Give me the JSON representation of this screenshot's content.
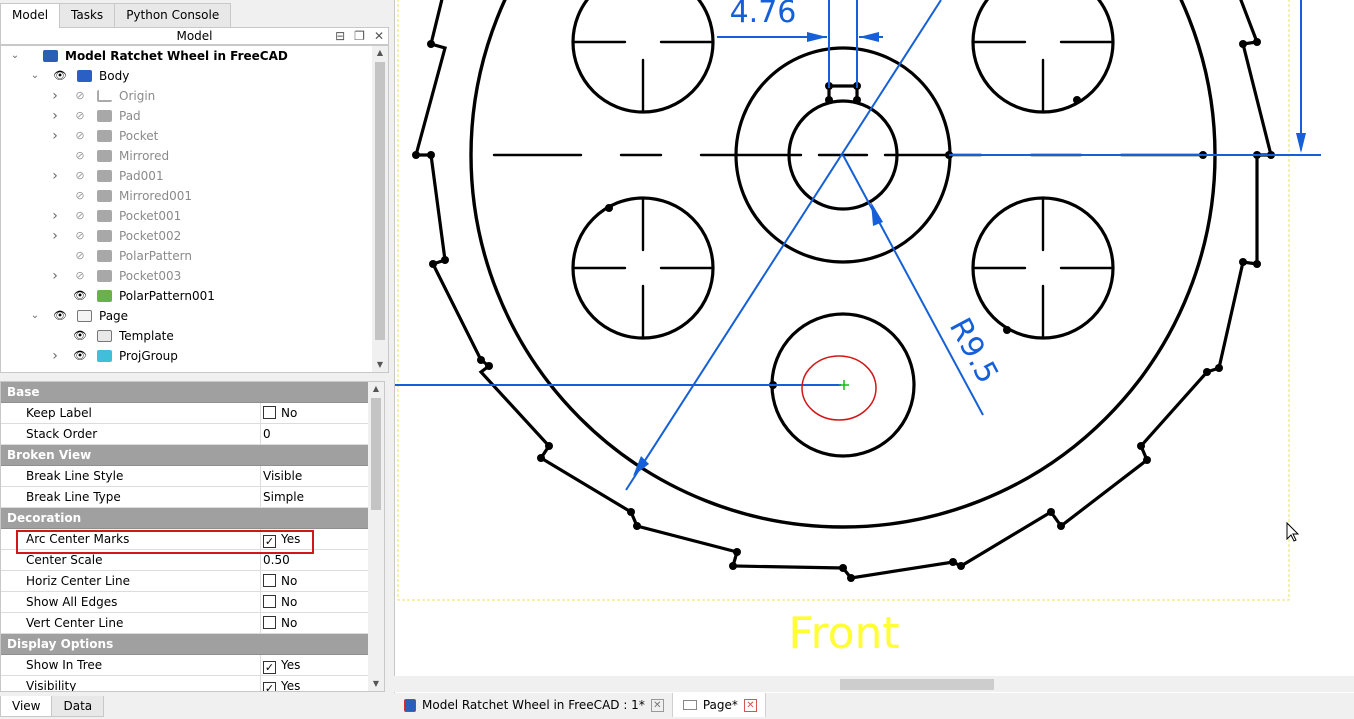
{
  "top_tabs": [
    "Model",
    "Tasks",
    "Python Console"
  ],
  "model_panel_title": "Model",
  "tree": [
    {
      "label": "Model Ratchet Wheel in FreeCAD",
      "depth": 0,
      "bold": true,
      "grey": false,
      "arrow": "open",
      "eye": "none",
      "icon": "doc"
    },
    {
      "label": "Body",
      "depth": 1,
      "bold": false,
      "grey": false,
      "arrow": "open",
      "eye": "visible",
      "icon": "body"
    },
    {
      "label": "Origin",
      "depth": 2,
      "bold": false,
      "grey": true,
      "arrow": "closed",
      "eye": "hidden",
      "icon": "origin"
    },
    {
      "label": "Pad",
      "depth": 2,
      "bold": false,
      "grey": true,
      "arrow": "closed",
      "eye": "hidden",
      "icon": "feature"
    },
    {
      "label": "Pocket",
      "depth": 2,
      "bold": false,
      "grey": true,
      "arrow": "closed",
      "eye": "hidden",
      "icon": "feature"
    },
    {
      "label": "Mirrored",
      "depth": 2,
      "bold": false,
      "grey": true,
      "arrow": "none",
      "eye": "hidden",
      "icon": "feature"
    },
    {
      "label": "Pad001",
      "depth": 2,
      "bold": false,
      "grey": true,
      "arrow": "closed",
      "eye": "hidden",
      "icon": "feature"
    },
    {
      "label": "Mirrored001",
      "depth": 2,
      "bold": false,
      "grey": true,
      "arrow": "none",
      "eye": "hidden",
      "icon": "feature"
    },
    {
      "label": "Pocket001",
      "depth": 2,
      "bold": false,
      "grey": true,
      "arrow": "closed",
      "eye": "hidden",
      "icon": "feature"
    },
    {
      "label": "Pocket002",
      "depth": 2,
      "bold": false,
      "grey": true,
      "arrow": "closed",
      "eye": "hidden",
      "icon": "feature"
    },
    {
      "label": "PolarPattern",
      "depth": 2,
      "bold": false,
      "grey": true,
      "arrow": "none",
      "eye": "hidden",
      "icon": "feature"
    },
    {
      "label": "Pocket003",
      "depth": 2,
      "bold": false,
      "grey": true,
      "arrow": "closed",
      "eye": "hidden",
      "icon": "feature"
    },
    {
      "label": "PolarPattern001",
      "depth": 2,
      "bold": false,
      "grey": false,
      "arrow": "none",
      "eye": "visible",
      "icon": "feature-active"
    },
    {
      "label": "Page",
      "depth": 1,
      "bold": false,
      "grey": false,
      "arrow": "open",
      "eye": "visible",
      "icon": "page"
    },
    {
      "label": "Template",
      "depth": 2,
      "bold": false,
      "grey": false,
      "arrow": "none",
      "eye": "visible",
      "icon": "template"
    },
    {
      "label": "ProjGroup",
      "depth": 2,
      "bold": false,
      "grey": false,
      "arrow": "closed",
      "eye": "visible",
      "icon": "projgroup"
    }
  ],
  "properties": [
    {
      "group": "Base"
    },
    {
      "name": "Keep Label",
      "check": false,
      "value": "No"
    },
    {
      "name": "Stack Order",
      "value": "0"
    },
    {
      "group": "Broken View"
    },
    {
      "name": "Break Line Style",
      "value": "Visible"
    },
    {
      "name": "Break Line Type",
      "value": "Simple"
    },
    {
      "group": "Decoration"
    },
    {
      "name": "Arc Center Marks",
      "check": true,
      "value": "Yes"
    },
    {
      "name": "Center Scale",
      "value": "0.50"
    },
    {
      "name": "Horiz Center Line",
      "check": false,
      "value": "No"
    },
    {
      "name": "Show All Edges",
      "check": false,
      "value": "No"
    },
    {
      "name": "Vert Center Line",
      "check": false,
      "value": "No"
    },
    {
      "group": "Display Options"
    },
    {
      "name": "Show In Tree",
      "check": true,
      "value": "Yes"
    },
    {
      "name": "Visibility",
      "check": true,
      "value": "Yes"
    }
  ],
  "bottom_tabs": [
    "View",
    "Data"
  ],
  "drawing": {
    "dim_width": "4.76",
    "dim_radius": "R9.5",
    "view_label": "Front",
    "line_color": "#000000",
    "dim_color": "#1560d8",
    "label_color": "#ffff33",
    "frame_color": "#e8e060",
    "highlight_color": "#d01818",
    "center_mark_color": "#10c010"
  },
  "doc_tabs": [
    {
      "label": "Model Ratchet Wheel in FreeCAD : 1*",
      "active": false
    },
    {
      "label": "Page*",
      "active": true
    }
  ]
}
